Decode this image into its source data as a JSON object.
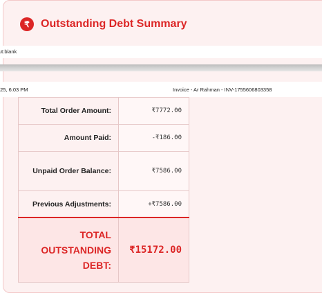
{
  "header": {
    "icon": "rupee-circle-icon",
    "icon_glyph": "₹",
    "title": "Outstanding Debt Summary",
    "accent_color": "#dc2626"
  },
  "print": {
    "url_fragment": "ut:blank",
    "date_fragment": "/25, 6:03 PM",
    "document_title": "Invoice - Ar Rahman - INV-1755606803358"
  },
  "summary": {
    "rows": [
      {
        "label": "Total Order Amount:",
        "value": "₹7772.00"
      },
      {
        "label": "Amount Paid:",
        "value": "-₹186.00"
      },
      {
        "label": "Unpaid Order Balance:",
        "value": "₹7586.00"
      },
      {
        "label": "Previous Adjustments:",
        "value": "+₹7586.00"
      }
    ],
    "total": {
      "label": "TOTAL OUTSTANDING DEBT:",
      "value": "₹15172.00"
    }
  }
}
